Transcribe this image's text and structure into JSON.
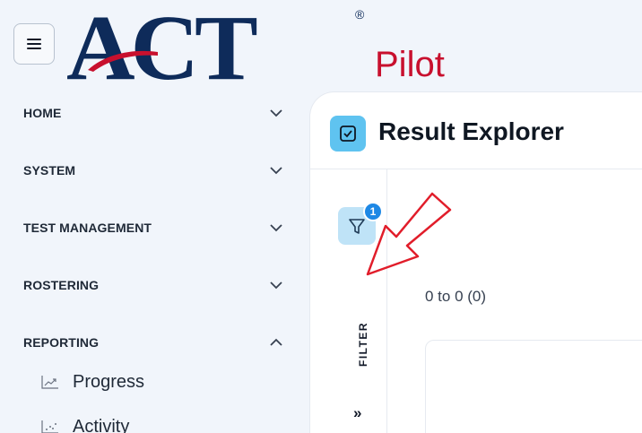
{
  "app": {
    "logo_text": "ACT",
    "logo_registered": "®",
    "product_name": "Pilot",
    "brand_colors": {
      "navy": "#0e2b5a",
      "red": "#c8102e"
    }
  },
  "header": {
    "menu_icon": "hamburger-icon"
  },
  "sidebar": {
    "items": [
      {
        "label": "HOME",
        "expanded": false
      },
      {
        "label": "SYSTEM",
        "expanded": false
      },
      {
        "label": "TEST MANAGEMENT",
        "expanded": false
      },
      {
        "label": "ROSTERING",
        "expanded": false
      },
      {
        "label": "REPORTING",
        "expanded": true
      }
    ],
    "reporting_sub_items": [
      {
        "label": "Progress",
        "icon": "trend-chart-icon"
      },
      {
        "label": "Activity",
        "icon": "scatter-chart-icon"
      }
    ]
  },
  "main": {
    "title": "Result Explorer",
    "title_icon": "checkbox-icon",
    "filter": {
      "label": "FILTER",
      "badge_count": "1",
      "expand_label": "»"
    },
    "result_count": "0 to 0 (0)"
  }
}
